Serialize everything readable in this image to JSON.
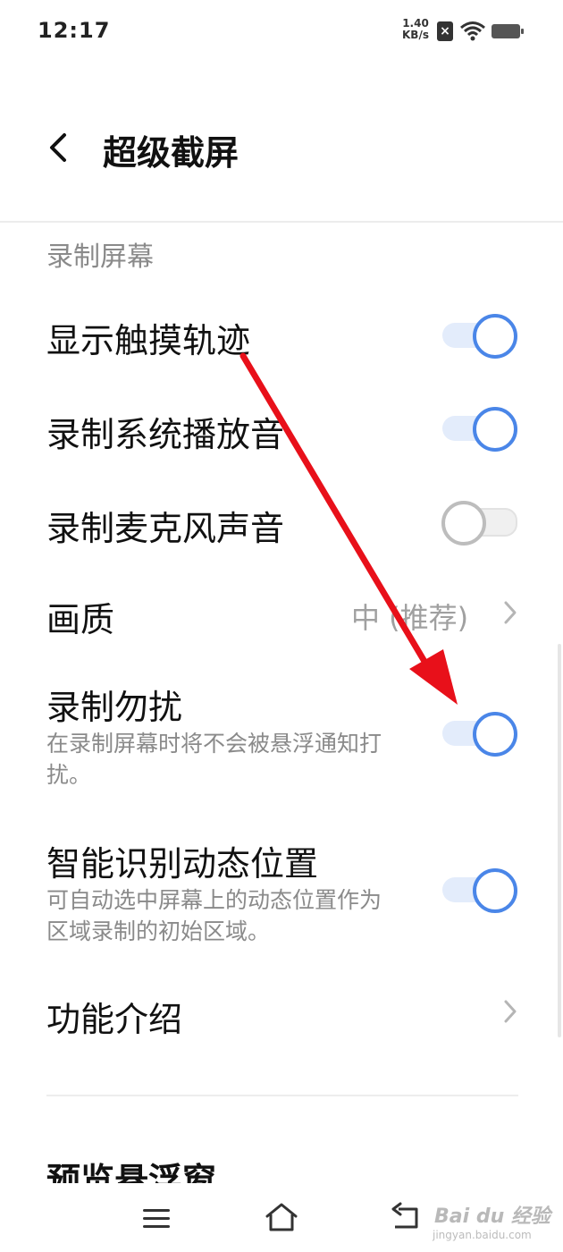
{
  "status_bar": {
    "time": "12:17",
    "net_speed_value": "1.40",
    "net_speed_unit": "KB/s"
  },
  "header": {
    "title": "超级截屏"
  },
  "section": {
    "label": "录制屏幕"
  },
  "settings": [
    {
      "title": "显示触摸轨迹",
      "toggle": "on"
    },
    {
      "title": "录制系统播放音",
      "toggle": "on"
    },
    {
      "title": "录制麦克风声音",
      "toggle": "off"
    },
    {
      "title": "画质",
      "value": "中 (推荐)"
    },
    {
      "title": "录制勿扰",
      "desc": "在录制屏幕时将不会被悬浮通知打扰。",
      "toggle": "on"
    },
    {
      "title": "智能识别动态位置",
      "desc": "可自动选中屏幕上的动态位置作为区域录制的初始区域。",
      "toggle": "on"
    },
    {
      "title": "功能介绍"
    }
  ],
  "next_section_title": "预览悬浮窗",
  "watermark": {
    "logo_text": "Bai du 经验",
    "url": "jingyan.baidu.com"
  },
  "colors": {
    "accent": "#4a86e8",
    "annotation_arrow": "#e8101a"
  },
  "icons": [
    "back-icon",
    "chevron-right-icon",
    "menu-icon",
    "home-icon",
    "back-nav-icon",
    "wifi-icon",
    "battery-icon",
    "sim-icon"
  ]
}
